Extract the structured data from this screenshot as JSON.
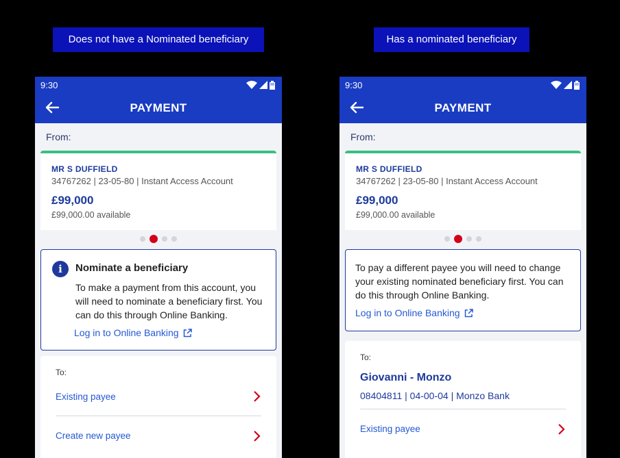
{
  "captions": {
    "left": "Does not have a Nominated beneficiary",
    "right": "Has a nominated beneficiary"
  },
  "status_bar": {
    "time": "9:30",
    "icons": [
      "wifi-icon",
      "signal-icon",
      "battery-icon"
    ]
  },
  "header": {
    "title": "PAYMENT",
    "back_icon": "arrow-left-icon"
  },
  "from": {
    "label": "From:",
    "account": {
      "name": "MR S DUFFIELD",
      "details": "34767262 | 23-05-80 | Instant Access Account",
      "balance": "£99,000",
      "available": "£99,000.00 available"
    },
    "carousel": {
      "count": 4,
      "active_index": 1
    }
  },
  "left_notice": {
    "title": "Nominate a beneficiary",
    "body": "To make a payment from this account, you will need to nominate a beneficiary first. You can do this through Online Banking.",
    "link": "Log in to Online Banking"
  },
  "right_notice": {
    "body": "To pay a different payee you will need to change your existing nominated beneficiary first. You can do this through Online Banking.",
    "link": "Log in to Online Banking"
  },
  "left_to": {
    "label": "To:",
    "options": [
      "Existing payee",
      "Create new payee"
    ]
  },
  "right_to": {
    "label": "To:",
    "payee_name": "Giovanni - Monzo",
    "payee_details": "08404811 | 04-00-04 | Monzo Bank",
    "options": [
      "Existing payee"
    ]
  },
  "colors": {
    "brand_blue": "#1a3cc2",
    "text_blue": "#1d3a9b",
    "link_blue": "#2458d4",
    "accent_green": "#3bbf82",
    "accent_red": "#d4001a",
    "caption_bg": "#0a12b8"
  }
}
